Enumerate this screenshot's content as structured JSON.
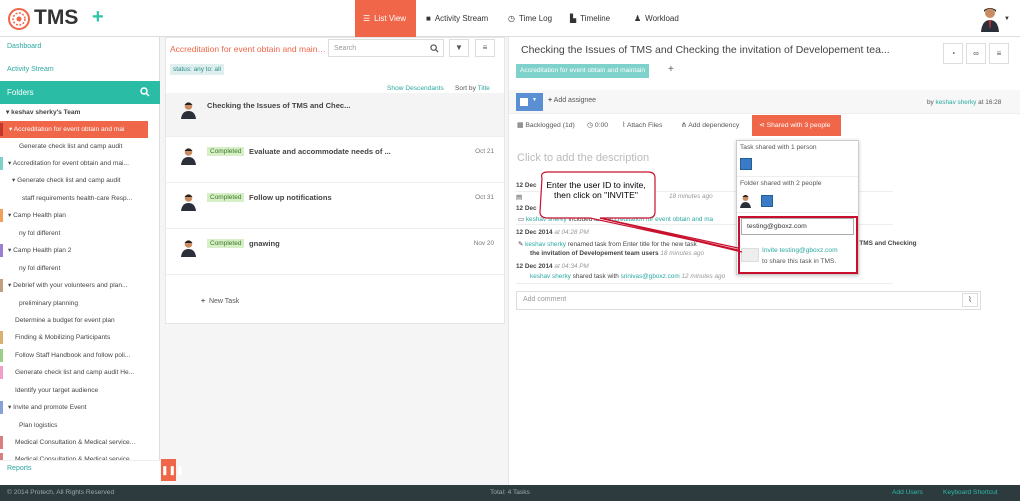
{
  "app": {
    "name": "TMS"
  },
  "nav": {
    "items": [
      {
        "label": "List View",
        "icon": "list-icon"
      },
      {
        "label": "Activity Stream",
        "icon": "comment-icon"
      },
      {
        "label": "Time Log",
        "icon": "clock-icon"
      },
      {
        "label": "Timeline",
        "icon": "timeline-icon"
      },
      {
        "label": "Workload",
        "icon": "user-icon"
      }
    ]
  },
  "sidebar": {
    "dashboard": "Dashboard",
    "activity_stream": "Activity Stream",
    "folders": "Folders",
    "reports": "Reports",
    "tree": [
      {
        "label": "keshav sherky's Team",
        "bold": true
      },
      {
        "label": "Accreditation for event obtain and mai"
      },
      {
        "label": "Generate check list and camp audit"
      },
      {
        "label": "Accreditation for event obtain and mai..."
      },
      {
        "label": "Generate check list and camp audit"
      },
      {
        "label": "staff requirements health-care Resp..."
      },
      {
        "label": "Camp Health plan"
      },
      {
        "label": "ny fol different"
      },
      {
        "label": "Camp Health plan 2"
      },
      {
        "label": "ny fol different"
      },
      {
        "label": "Debrief with your volunteers and plan..."
      },
      {
        "label": "preliminary planning"
      },
      {
        "label": "Determine a budget for event plan"
      },
      {
        "label": "Finding & Mobilizing Participants"
      },
      {
        "label": "Follow Staff Handbook and follow poli..."
      },
      {
        "label": "Generate check list and camp audit He..."
      },
      {
        "label": "Identify your target audience"
      },
      {
        "label": "Invite and promote Event"
      },
      {
        "label": "Plan logistics"
      },
      {
        "label": "Medical Consultation & Medical service..."
      },
      {
        "label": "Medical Consultation & Medical service..."
      }
    ]
  },
  "list": {
    "title": "Accreditation for event obtain and maintain",
    "search_placeholder": "Search",
    "status_filter": "status: any   to: all",
    "show_descendants": "Show Descendants",
    "sort_by": "Sort by",
    "sort_field": "Title",
    "new_task": "New Task",
    "tasks": [
      {
        "title": "Checking the Issues of TMS and Chec...",
        "badge": "",
        "date": ""
      },
      {
        "title": "Evaluate and accommodate needs of ...",
        "badge": "Completed",
        "date": "Oct 21"
      },
      {
        "title": "Follow up notifications",
        "badge": "Completed",
        "date": "Oct 31"
      },
      {
        "title": "gnawing",
        "badge": "Completed",
        "date": "Nov 20"
      }
    ]
  },
  "detail": {
    "title": "Checking the Issues of TMS and Checking the invitation of Developement tea...",
    "folder_tag": "Accreditation for event obtain and maintain",
    "add_assignee": "Add assignee",
    "by": "by",
    "author": "keshav sherky",
    "at_time": "at 16:28",
    "toolbar": {
      "backlogged": "Backlogged (1d)",
      "time": "0:00",
      "attach": "Attach Files",
      "dependency": "Add dependency",
      "shared": "Shared with 3 people"
    },
    "description_placeholder": "Click to add the description",
    "activity": {
      "date1": "12 Dec",
      "user": "keshav sherky",
      "included_text": "included task",
      "included_link": "Accreditation for event obtain and ma",
      "ago1": "18 minutes ago",
      "date2": "12 Dec 2014",
      "time2": "at 04:28 PM",
      "renamed_text": "renamed task from Enter title for the new task",
      "renamed_to": "Checking the Issues of TMS and Checking",
      "renamed_to2": "the invitation of Developement team users",
      "ago2": "18 minutes ago",
      "date3": "12 Dec 2014",
      "time3": "at 04:34 PM",
      "shared_text": "shared task with",
      "shared_email": "srinivas@gboxz.com",
      "ago3": "12 minutes ago"
    },
    "add_comment": "Add comment"
  },
  "share_popup": {
    "task_shared": "Task shared with 1 person",
    "folder_shared": "Folder shared with 2 people",
    "invite_value": "testing@gboxz.com",
    "invite_link": "Invite testing@gboxz.com",
    "invite_note": "to share this task in TMS."
  },
  "callout": {
    "text": "Enter the user ID to invite, then click on \"INVITE\""
  },
  "footer": {
    "copyright": "© 2014 Protech, All Rights Reserved",
    "total": "Total: 4 Tasks",
    "add_users": "Add Users",
    "keyboard": "Keyboard Shortcut"
  },
  "colors": {
    "accent": "#f06649",
    "teal": "#2bbca6",
    "footer": "#2d3a3e"
  }
}
